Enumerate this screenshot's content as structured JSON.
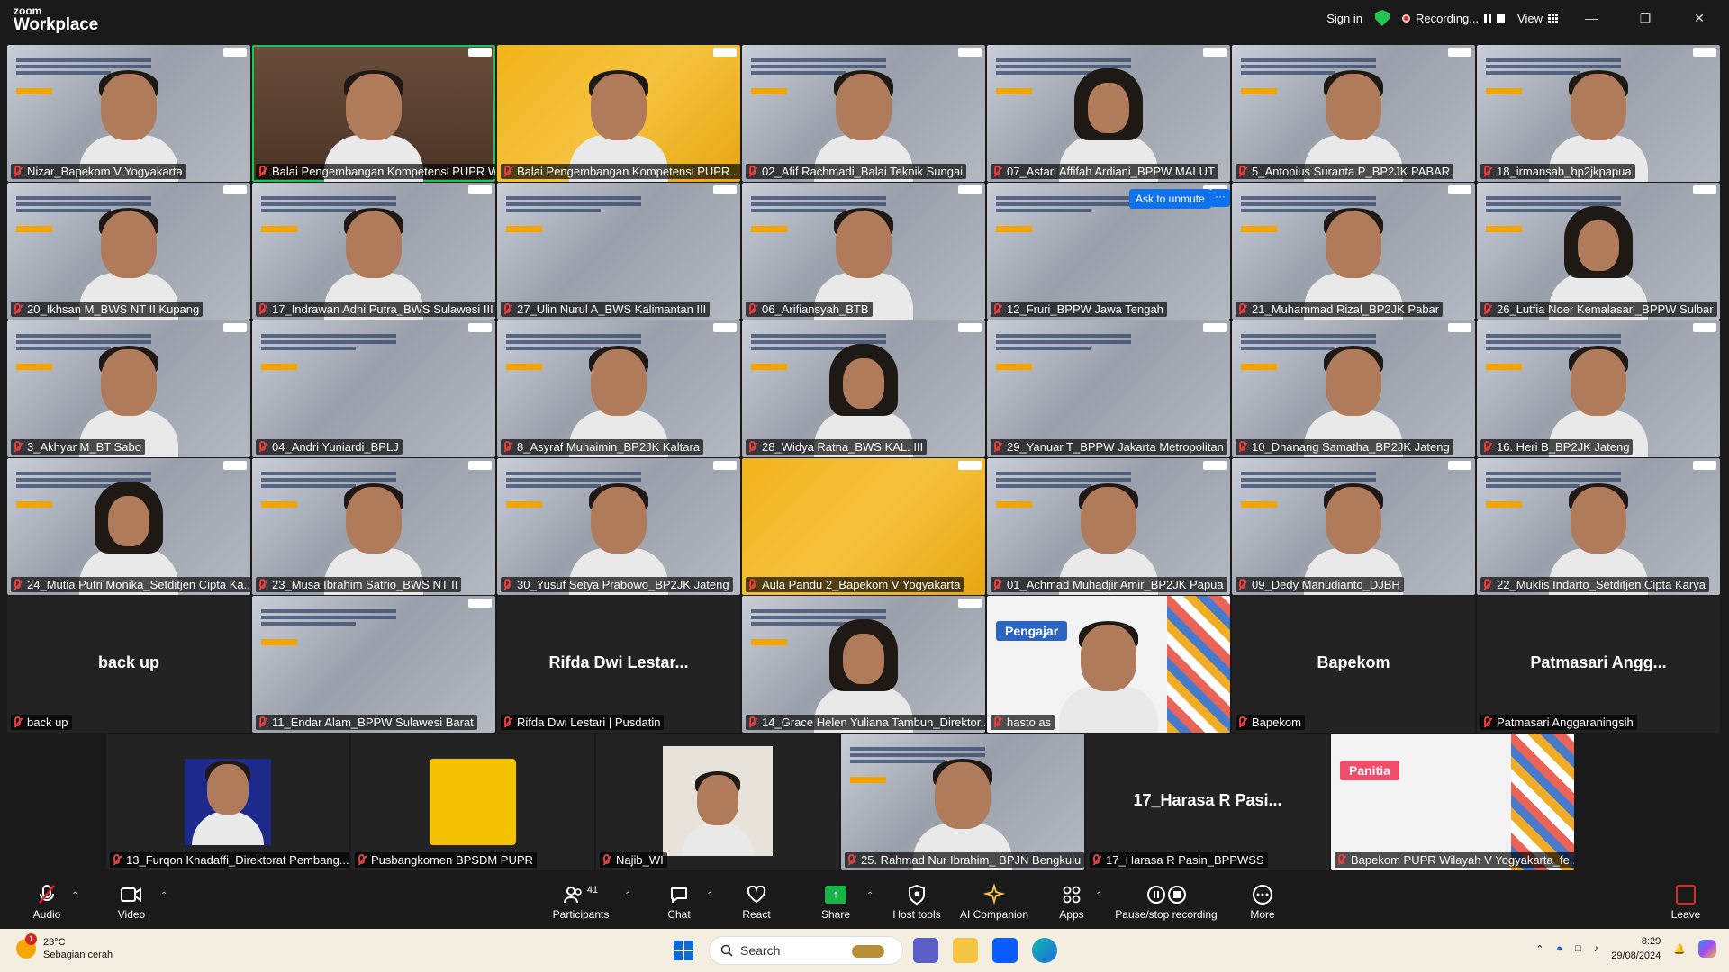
{
  "app": {
    "brand_small": "zoom",
    "brand_large": "Workplace",
    "sign_in": "Sign in",
    "recording_label": "Recording...",
    "view_label": "View"
  },
  "ask_to_unmute": "Ask to unmute",
  "ask_more": "···",
  "tiles": [
    {
      "name": "Nizar_Bapekom V Yogyakarta",
      "bg": "slide"
    },
    {
      "name": "Balai Pengembangan Kompetensi PUPR Wil...",
      "bg": "room",
      "active": true
    },
    {
      "name": "Balai Pengembangan Kompetensi PUPR ...",
      "bg": "gold"
    },
    {
      "name": "02_Afif Rachmadi_Balai Teknik Sungai",
      "bg": "slide"
    },
    {
      "name": "07_Astari Affifah Ardiani_BPPW MALUT",
      "bg": "slide",
      "hijab": true
    },
    {
      "name": "5_Antonius Suranta P_BP2JK PABAR",
      "bg": "slide"
    },
    {
      "name": "18_irmansah_bp2jkpapua",
      "bg": "slide"
    },
    {
      "name": "20_Ikhsan M_BWS NT II Kupang",
      "bg": "slide"
    },
    {
      "name": "17_Indrawan Adhi Putra_BWS Sulawesi III",
      "bg": "slide"
    },
    {
      "name": "27_Ulin Nurul A_BWS Kalimantan III",
      "bg": "slide",
      "empty": true
    },
    {
      "name": "06_Arifiansyah_BTB",
      "bg": "slide"
    },
    {
      "name": "12_Fruri_BPPW Jawa Tengah",
      "bg": "slide",
      "empty": true
    },
    {
      "name": "21_Muhammad Rizal_BP2JK Pabar",
      "bg": "slide"
    },
    {
      "name": "26_Lutfia Noer Kemalasari_BPPW Sulbar",
      "bg": "slide",
      "hijab": true
    },
    {
      "name": "3_Akhyar M_BT Sabo",
      "bg": "slide"
    },
    {
      "name": "04_Andri Yuniardi_BPLJ",
      "bg": "slide",
      "empty": true
    },
    {
      "name": "8_Asyraf Muhaimin_BP2JK Kaltara",
      "bg": "slide"
    },
    {
      "name": "28_Widya Ratna_BWS KAL. III",
      "bg": "slide",
      "hijab": true
    },
    {
      "name": "29_Yanuar T_BPPW Jakarta Metropolitan",
      "bg": "slide",
      "empty": true
    },
    {
      "name": "10_Dhanang Samatha_BP2JK Jateng",
      "bg": "slide"
    },
    {
      "name": "16. Heri B_BP2JK Jateng",
      "bg": "slide"
    },
    {
      "name": "24_Mutia Putri Monika_Setditjen Cipta Ka...",
      "bg": "slide",
      "hijab": true
    },
    {
      "name": "23_Musa Ibrahim Satrio_BWS NT II",
      "bg": "slide"
    },
    {
      "name": "30_Yusuf Setya Prabowo_BP2JK Jateng",
      "bg": "slide"
    },
    {
      "name": "Aula Pandu 2_Bapekom V Yogyakarta",
      "bg": "gold",
      "empty": true
    },
    {
      "name": "01_Achmad Muhadjir Amir_BP2JK Papua",
      "bg": "slide"
    },
    {
      "name": "09_Dedy Manudianto_DJBH",
      "bg": "slide"
    },
    {
      "name": "22_Muklis Indarto_Setditjen Cipta Karya",
      "bg": "slide"
    },
    {
      "name": "back up",
      "bg": "dark",
      "center": "back up"
    },
    {
      "name": "11_Endar Alam_BPPW Sulawesi Barat",
      "bg": "slide",
      "empty": true
    },
    {
      "name": "Rifda Dwi Lestari | Pusdatin",
      "bg": "dark",
      "center": "Rifda Dwi Lestar..."
    },
    {
      "name": "14_Grace Helen Yuliana Tambun_Direktor...",
      "bg": "slide",
      "hijab": true
    },
    {
      "name": "hasto as",
      "bg": "white",
      "badge": "Pengajar"
    },
    {
      "name": "Bapekom",
      "bg": "dark",
      "center": "Bapekom"
    },
    {
      "name": "Patmasari Anggaraningsih",
      "bg": "dark",
      "center": "Patmasari Angg..."
    }
  ],
  "bottom_row": [
    {
      "name": "13_Furqon Khadaffi_Direktorat Pembang...",
      "kind": "photo"
    },
    {
      "name": "Pusbangkomen BPSDM PUPR",
      "kind": "logo"
    },
    {
      "name": "Najib_WI",
      "kind": "photo2"
    },
    {
      "name": "25. Rahmad Nur Ibrahim_ BPJN Bengkulu",
      "kind": "slide"
    },
    {
      "name": "17_Harasa R Pasin_BPPWSS",
      "kind": "dark",
      "center": "17_Harasa R Pasi..."
    },
    {
      "name": "Bapekom PUPR Wilayah V Yogyakarta_fe...",
      "kind": "white",
      "badge": "Panitia"
    }
  ],
  "toolbar": {
    "audio": "Audio",
    "video": "Video",
    "participants": "Participants",
    "participants_count": "41",
    "chat": "Chat",
    "react": "React",
    "share": "Share",
    "host_tools": "Host tools",
    "ai_companion": "AI Companion",
    "apps": "Apps",
    "pause_stop": "Pause/stop recording",
    "more": "More",
    "leave": "Leave"
  },
  "taskbar": {
    "temp": "23°C",
    "weather_desc": "Sebagian cerah",
    "weather_badge": "1",
    "search_placeholder": "Search",
    "time": "8:29",
    "date": "29/08/2024"
  }
}
